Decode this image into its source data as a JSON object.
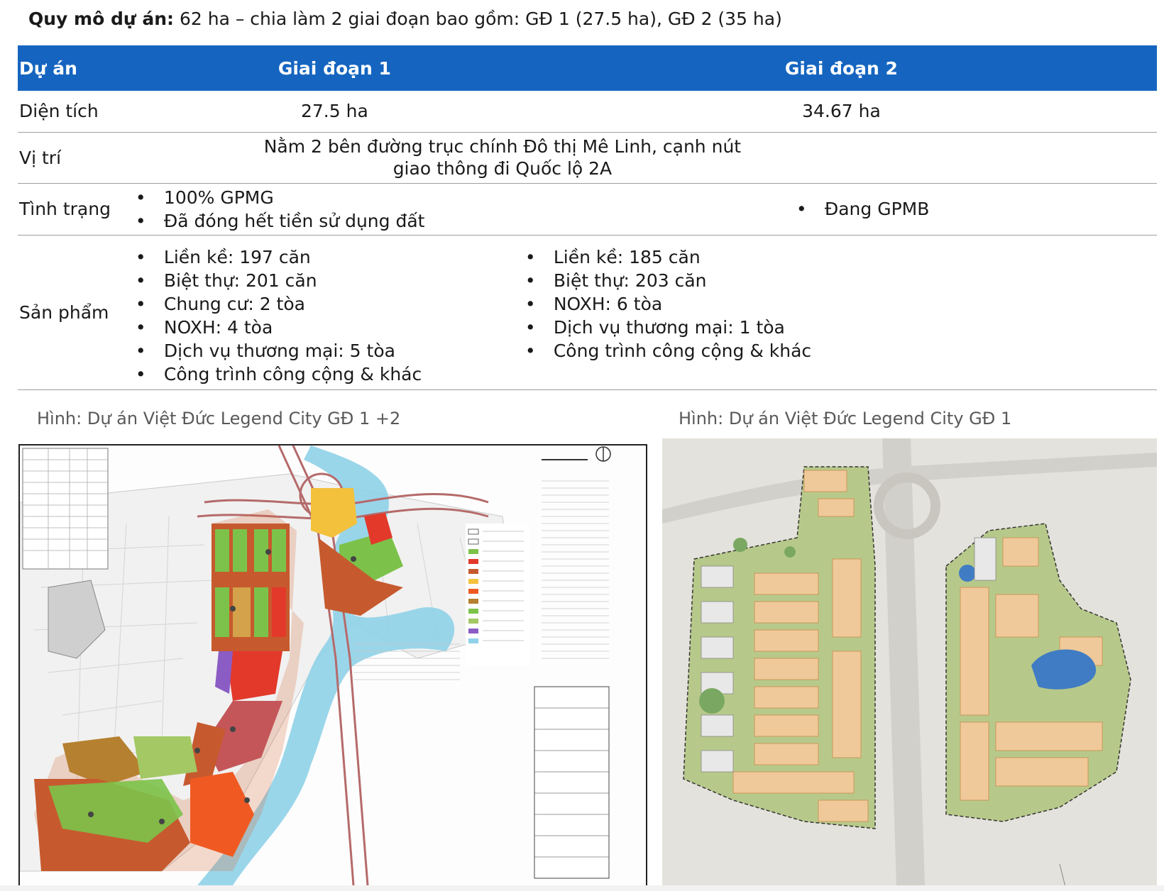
{
  "headline": {
    "label": "Quy mô dự án:",
    "text": " 62 ha – chia làm 2 giai đoạn bao gồm: GĐ 1 (27.5 ha), GĐ 2 (35 ha)"
  },
  "table": {
    "headers": [
      "Dự án",
      "Giai đoạn 1",
      "Giai đoạn 2"
    ],
    "area": {
      "label": "Diện tích",
      "gd1": "27.5 ha",
      "gd2": "34.67 ha"
    },
    "location": {
      "label": "Vị trí",
      "text": "Nằm 2 bên đường trục chính Đô thị Mê Linh, cạnh nút giao thông đi Quốc lộ 2A"
    },
    "status": {
      "label": "Tình trạng",
      "gd1": [
        "100% GPMG",
        "Đã đóng hết tiền sử dụng đất"
      ],
      "gd2": [
        "Đang GPMB"
      ]
    },
    "products": {
      "label": "Sản phẩm",
      "gd1": [
        "Liền kề: 197 căn",
        "Biệt thự: 201 căn",
        "Chung cư: 2 tòa",
        "NOXH: 4 tòa",
        "Dịch vụ thương mại: 5 tòa",
        "Công trình công cộng & khác"
      ],
      "gd2": [
        "Liền kề: 185 căn",
        "Biệt thự: 203 căn",
        "NOXH: 6 tòa",
        "Dịch vụ thương mại: 1 tòa",
        "Công trình công cộng & khác"
      ]
    }
  },
  "captions": {
    "left": "Hình: Dự án Việt Đức Legend City GĐ 1 +2",
    "right": "Hình: Dự án Việt Đức Legend City GĐ 1"
  },
  "colors": {
    "header_bg": "#1565c0",
    "header_text": "#ffffff",
    "caption": "#595959"
  }
}
